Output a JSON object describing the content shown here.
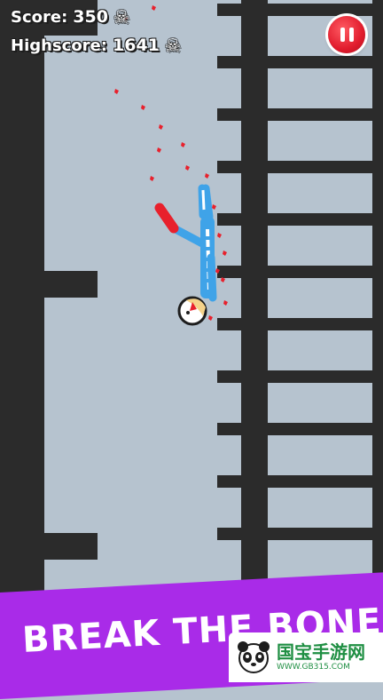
{
  "hud": {
    "score_label": "Score:",
    "score_value": "350",
    "highscore_label": "Highscore:",
    "highscore_value": "1641",
    "skull_icon": "skull-crossbones-icon"
  },
  "pause_button": {
    "icon": "pause-icon",
    "color": "#e11c2d"
  },
  "banner": {
    "text": "BREAK THE BONES",
    "color": "#a92be8"
  },
  "watermark": {
    "text": "国宝手游网",
    "url": "WWW.GB315.COM"
  },
  "colors": {
    "background": "#b6c3cf",
    "wall": "#2b2b2b",
    "limb_blue": "#3fa3e8",
    "glove_red": "#e8202c",
    "blood": "#e8202c"
  }
}
